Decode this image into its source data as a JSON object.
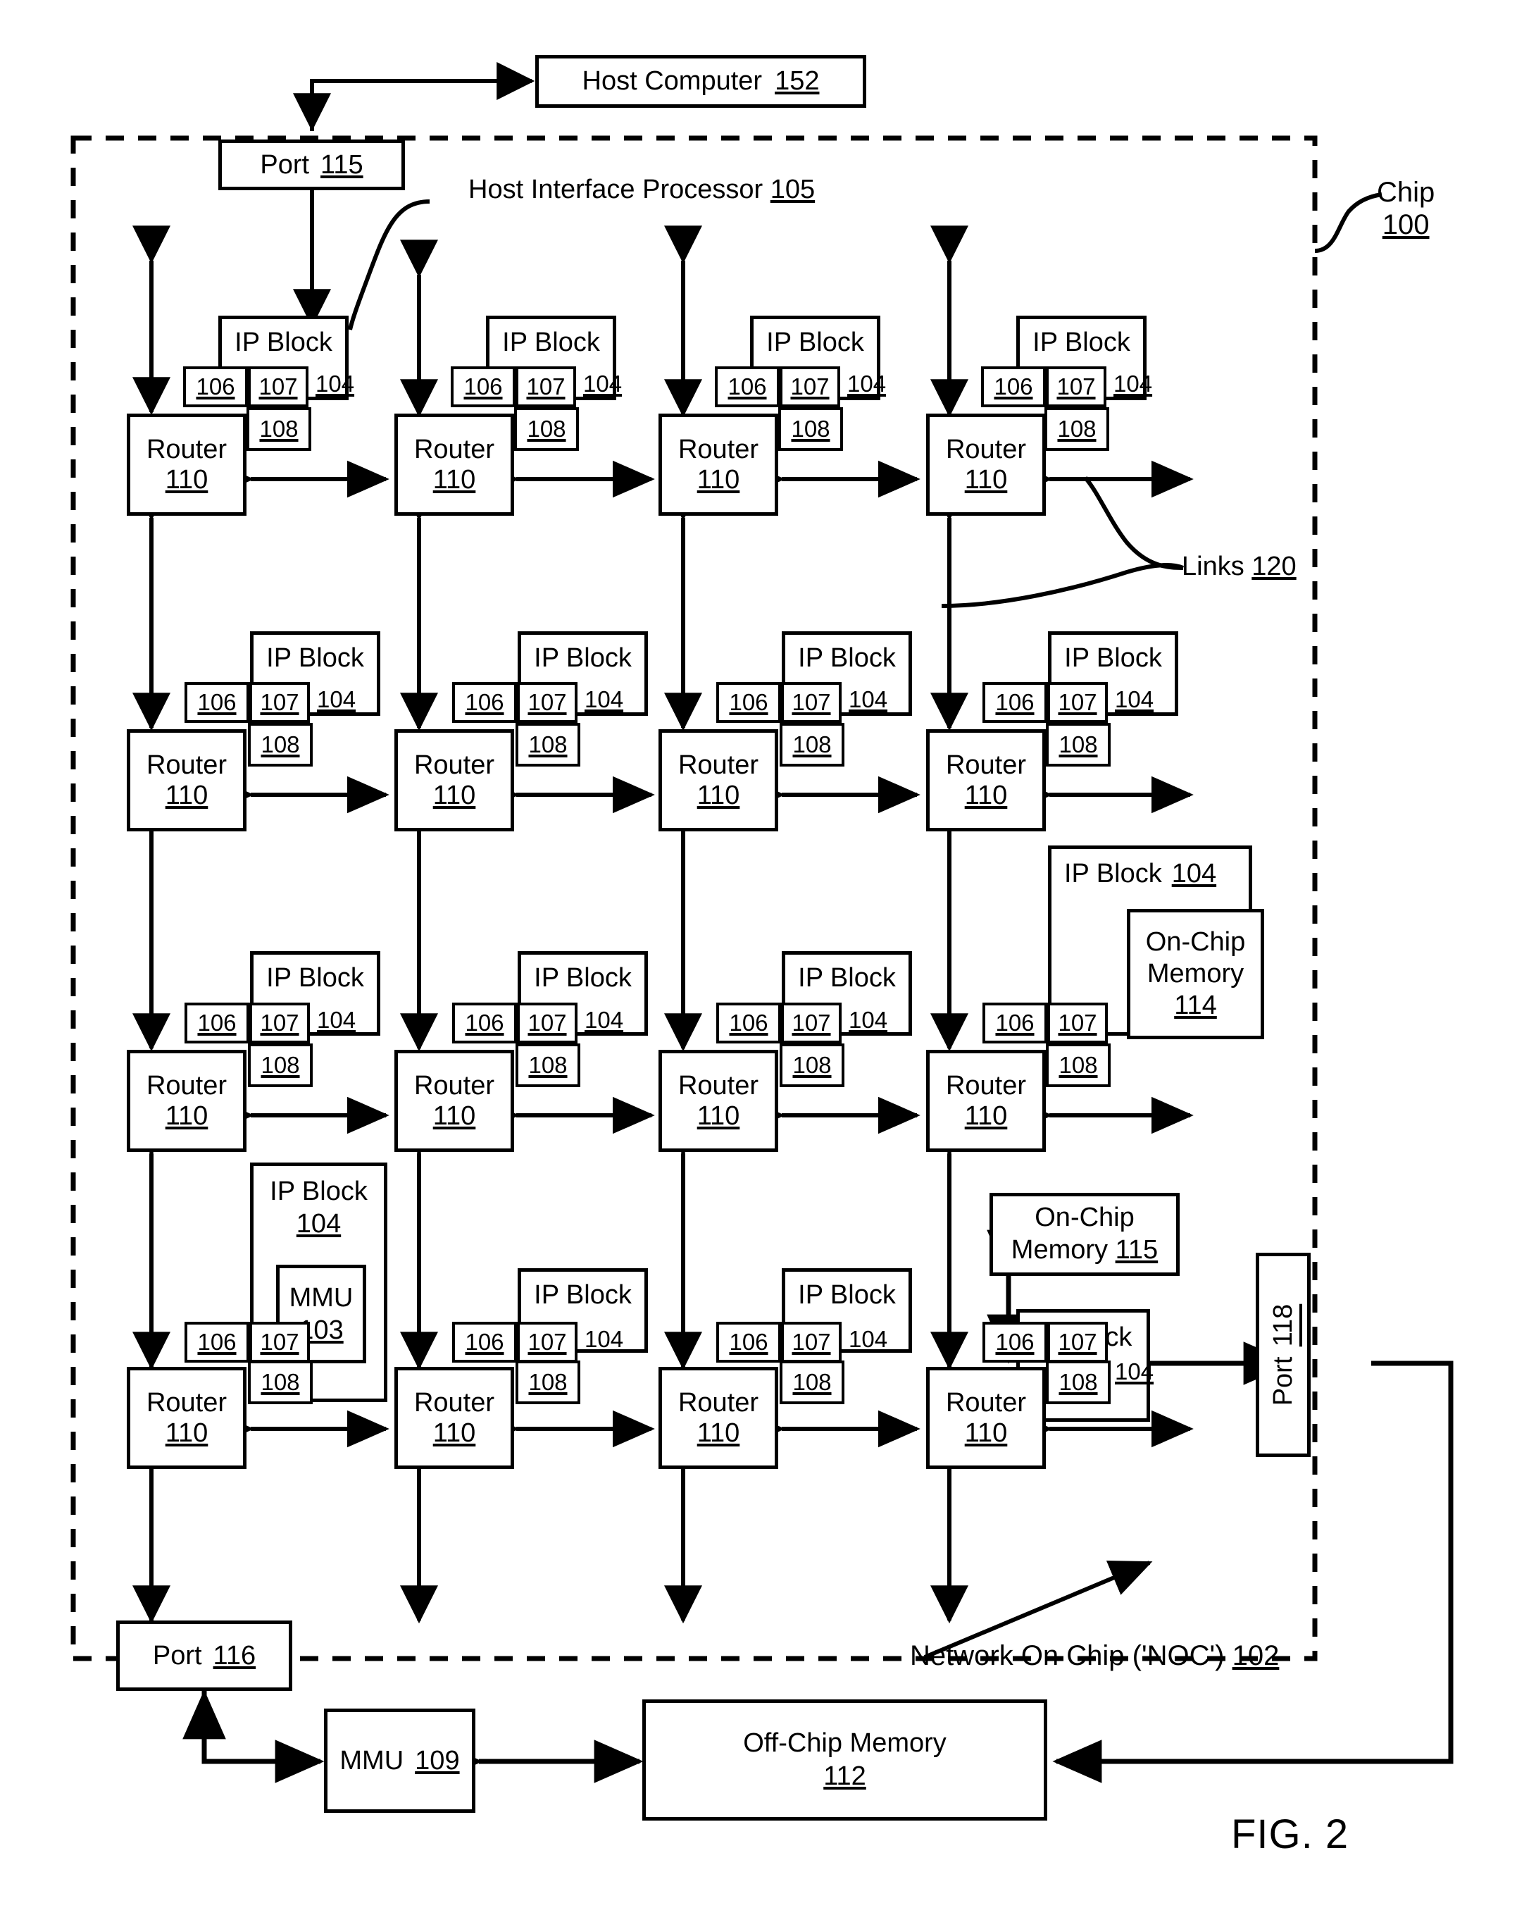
{
  "figure": {
    "caption": "FIG. 2"
  },
  "chip": {
    "label_line1": "Chip",
    "label_line2": "100"
  },
  "noc": {
    "label": "Network On Chip ('NOC') 102",
    "ref": "102"
  },
  "host": {
    "title": "Host Computer",
    "ref": "152"
  },
  "host_interface_processor": {
    "label": "Host Interface Processor",
    "ref": "105"
  },
  "links": {
    "label": "Links",
    "ref": "120"
  },
  "ports": {
    "top": {
      "label": "Port",
      "ref": "115"
    },
    "bottom": {
      "label": "Port",
      "ref": "116"
    },
    "right": {
      "label": "Port",
      "ref": "118"
    }
  },
  "mmu_offchip": {
    "label": "MMU",
    "ref": "109"
  },
  "offchip_memory": {
    "label": "Off-Chip Memory",
    "ref": "112"
  },
  "onchip_memory_114": {
    "line1": "On-Chip",
    "line2": "Memory",
    "ref": "114"
  },
  "onchip_memory_115": {
    "line1": "On-Chip",
    "line2": "Memory 115",
    "ref": "115"
  },
  "mmu_onchip": {
    "label": "MMU",
    "ref": "103"
  },
  "cell": {
    "router_label": "Router",
    "router_ref": "110",
    "ipblock_label": "IP Block",
    "ipblock_ref": "104",
    "badge_106": "106",
    "badge_107": "107",
    "badge_108": "108"
  },
  "grid": {
    "rows": 4,
    "cols": 4,
    "cells": [
      {
        "row": 1,
        "col": 1,
        "router": "110",
        "ip": "104",
        "variant": "standard"
      },
      {
        "row": 1,
        "col": 2,
        "router": "110",
        "ip": "104",
        "variant": "standard"
      },
      {
        "row": 1,
        "col": 3,
        "router": "110",
        "ip": "104",
        "variant": "standard"
      },
      {
        "row": 1,
        "col": 4,
        "router": "110",
        "ip": "104",
        "variant": "standard"
      },
      {
        "row": 2,
        "col": 1,
        "router": "110",
        "ip": "104",
        "variant": "standard"
      },
      {
        "row": 2,
        "col": 2,
        "router": "110",
        "ip": "104",
        "variant": "standard"
      },
      {
        "row": 2,
        "col": 3,
        "router": "110",
        "ip": "104",
        "variant": "standard"
      },
      {
        "row": 2,
        "col": 4,
        "router": "110",
        "ip": "104",
        "variant": "standard"
      },
      {
        "row": 3,
        "col": 1,
        "router": "110",
        "ip": "104",
        "variant": "standard"
      },
      {
        "row": 3,
        "col": 2,
        "router": "110",
        "ip": "104",
        "variant": "standard"
      },
      {
        "row": 3,
        "col": 3,
        "router": "110",
        "ip": "104",
        "variant": "standard"
      },
      {
        "row": 3,
        "col": 4,
        "router": "110",
        "ip": "104",
        "variant": "onchip-memory-114"
      },
      {
        "row": 4,
        "col": 1,
        "router": "110",
        "ip": "104",
        "variant": "mmu-103"
      },
      {
        "row": 4,
        "col": 2,
        "router": "110",
        "ip": "104",
        "variant": "standard"
      },
      {
        "row": 4,
        "col": 3,
        "router": "110",
        "ip": "104",
        "variant": "standard"
      },
      {
        "row": 4,
        "col": 4,
        "router": "110",
        "ip": "104",
        "variant": "port-118"
      }
    ]
  }
}
